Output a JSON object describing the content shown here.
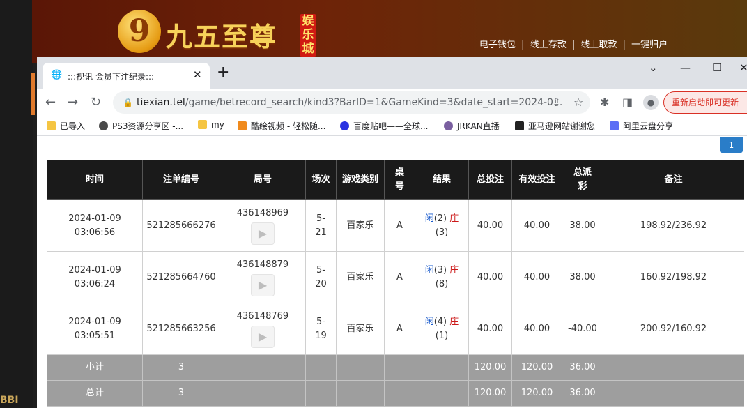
{
  "site": {
    "logo_char": "9",
    "logo_text": "九五至尊",
    "logo_side": "娱乐城",
    "links": [
      "电子钱包",
      "线上存款",
      "线上取款",
      "一键归户"
    ],
    "separator": "|"
  },
  "background": {
    "bottom_text": "BBI"
  },
  "browser": {
    "tab_title": ":::视讯 会员下注纪录:::",
    "tab_close": "✕",
    "new_tab": "+",
    "window_controls": {
      "dropdown": "⌄",
      "minimize": "—",
      "maximize": "☐",
      "close": "✕"
    },
    "url_host": "tiexian.tel",
    "url_path": "/game/betrecord_search/kind3?BarID=1&GameKind=3&date_start=2024-0...",
    "restart_label": "重新启动即可更新",
    "bookmarks": [
      {
        "label": "已导入",
        "icon": "folder-icon",
        "color": "#f5c542"
      },
      {
        "label": "PS3资源分享区 -...",
        "icon": "site-icon",
        "color": "#4a4a4a"
      },
      {
        "label": "my",
        "icon": "folder-icon",
        "color": "#f5c542"
      },
      {
        "label": "酷绘视频 - 轻松随...",
        "icon": "k-icon",
        "color": "#f08a1c"
      },
      {
        "label": "百度贴吧——全球...",
        "icon": "paw-icon",
        "color": "#2932e1"
      },
      {
        "label": "JRKAN直播",
        "icon": "site-icon",
        "color": "#7a5fa0"
      },
      {
        "label": "亚马逊网站谢谢您",
        "icon": "a-icon",
        "color": "#222222"
      },
      {
        "label": "阿里云盘分享",
        "icon": "cloud-icon",
        "color": "#5b6ef5"
      }
    ]
  },
  "pagination": {
    "current": "1"
  },
  "table": {
    "headers": [
      "时间",
      "注单编号",
      "局号",
      "场次",
      "游戏类别",
      "桌号",
      "结果",
      "总投注",
      "有效投注",
      "总派彩",
      "备注"
    ],
    "rows": [
      {
        "date": "2024-01-09",
        "time": "03:06:56",
        "bet_id": "521285666276",
        "round": "436148969",
        "session": "5-21",
        "game": "百家乐",
        "table": "A",
        "result_player": "闲",
        "result_player_val": "(2)",
        "result_banker": "庄",
        "result_banker_val": "(3)",
        "total_bet": "40.00",
        "valid_bet": "40.00",
        "payout": "38.00",
        "note": "198.92/236.92"
      },
      {
        "date": "2024-01-09",
        "time": "03:06:24",
        "bet_id": "521285664760",
        "round": "436148879",
        "session": "5-20",
        "game": "百家乐",
        "table": "A",
        "result_player": "闲",
        "result_player_val": "(3)",
        "result_banker": "庄",
        "result_banker_val": "(8)",
        "total_bet": "40.00",
        "valid_bet": "40.00",
        "payout": "38.00",
        "note": "160.92/198.92"
      },
      {
        "date": "2024-01-09",
        "time": "03:05:51",
        "bet_id": "521285663256",
        "round": "436148769",
        "session": "5-19",
        "game": "百家乐",
        "table": "A",
        "result_player": "闲",
        "result_player_val": "(4)",
        "result_banker": "庄",
        "result_banker_val": "(1)",
        "total_bet": "40.00",
        "valid_bet": "40.00",
        "payout": "-40.00",
        "note": "200.92/160.92"
      }
    ],
    "subtotal": {
      "label": "小计",
      "count": "3",
      "total_bet": "120.00",
      "valid_bet": "120.00",
      "payout": "36.00"
    },
    "total": {
      "label": "总计",
      "count": "3",
      "total_bet": "120.00",
      "valid_bet": "120.00",
      "payout": "36.00"
    }
  },
  "colors": {
    "player": "#1a5bcc",
    "banker": "#cc1a1a",
    "header_bg": "#1a1a1a",
    "summary_bg": "#9e9e9e",
    "accent": "#2a7dc8"
  }
}
